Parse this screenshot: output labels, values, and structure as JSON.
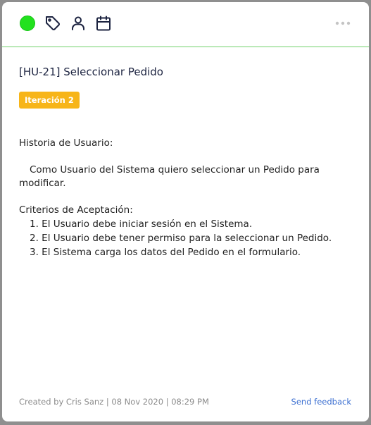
{
  "colors": {
    "status": "#22e11e",
    "badge": "#f7b519",
    "link": "#3b6fd1",
    "divider": "#6fd06a"
  },
  "toolbar": {
    "icons": [
      "status-indicator",
      "tag-icon",
      "user-icon",
      "calendar-icon"
    ],
    "more_icon": "more-horizontal-icon"
  },
  "story": {
    "title": "[HU-21] Seleccionar Pedido",
    "badge": "Iteración 2",
    "description": {
      "section1_heading": "Historia de Usuario:",
      "section1_text": "Como Usuario del Sistema quiero seleccionar un Pedido para modificar.",
      "section2_heading": "Criterios de Aceptación:",
      "criteria": [
        "1. El Usuario debe iniciar sesión en el Sistema.",
        "2. El Usuario debe tener permiso para la seleccionar un Pedido.",
        "3. El Sistema carga los datos del Pedido en el formulario."
      ]
    }
  },
  "footer": {
    "meta": "Created by Cris Sanz | 08 Nov 2020 | 08:29 PM",
    "feedback_link": "Send feedback"
  }
}
